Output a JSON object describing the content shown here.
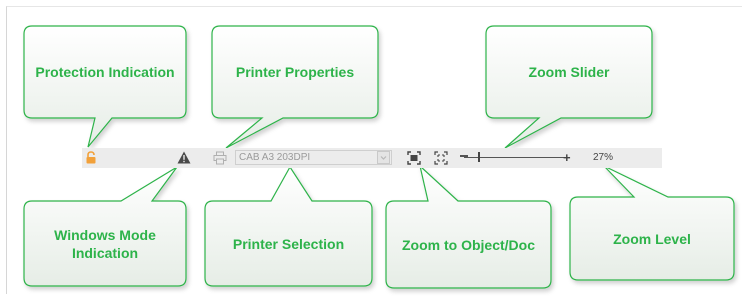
{
  "callouts": {
    "protection": "Protection Indication",
    "printer_properties": "Printer Properties",
    "zoom_slider": "Zoom Slider",
    "windows_mode": "Windows Mode Indication",
    "printer_selection": "Printer Selection",
    "zoom_to": "Zoom to Object/Doc",
    "zoom_level": "Zoom Level"
  },
  "statusbar": {
    "printer_name": "CAB A3 203DPI",
    "zoom_level": "27%",
    "zoom_fraction": 0.27
  },
  "icons": {
    "protection": "lock-icon",
    "windows_mode": "warning-icon",
    "printer_properties": "printer-icon",
    "zoom_to_object": "zoom-to-object-icon",
    "zoom_to_document": "zoom-to-document-icon",
    "printer_dropdown": "chevron-down-icon"
  },
  "colors": {
    "callout_text": "#2db34a",
    "callout_border": "#2db34a",
    "callout_fill_top": "#ffffff",
    "callout_fill_bottom": "#e6ede6",
    "statusbar_bg": "#ececec",
    "lock": "#f2a13a"
  }
}
